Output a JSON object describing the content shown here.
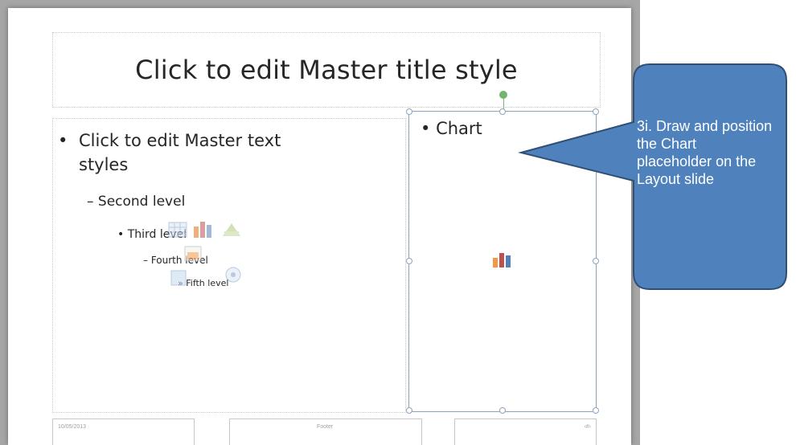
{
  "slide": {
    "title": "Click to edit Master title style",
    "content_levels": {
      "level1_line1": "Click to edit Master text",
      "level1_line2": "styles",
      "level2": "Second level",
      "level3": "Third level",
      "level4": "Fourth level",
      "level5": "Fifth level"
    },
    "bullets": {
      "level1": "•",
      "level2": "–",
      "level3": "•",
      "level4": "–",
      "level5": "»"
    },
    "chart_placeholder_label": "Chart",
    "footer": {
      "date": "10/05/2013",
      "text": "Footer",
      "number": "‹#›"
    }
  },
  "callout": {
    "text": "3i. Draw and position the Chart placeholder on the Layout slide",
    "fill_color": "#4f81bd",
    "border_color": "#2f4f75"
  },
  "icons": [
    "table-icon",
    "bar-chart-icon",
    "picture-icon",
    "smartart-icon",
    "clipart-icon",
    "media-icon",
    "chart-insert-icon"
  ]
}
